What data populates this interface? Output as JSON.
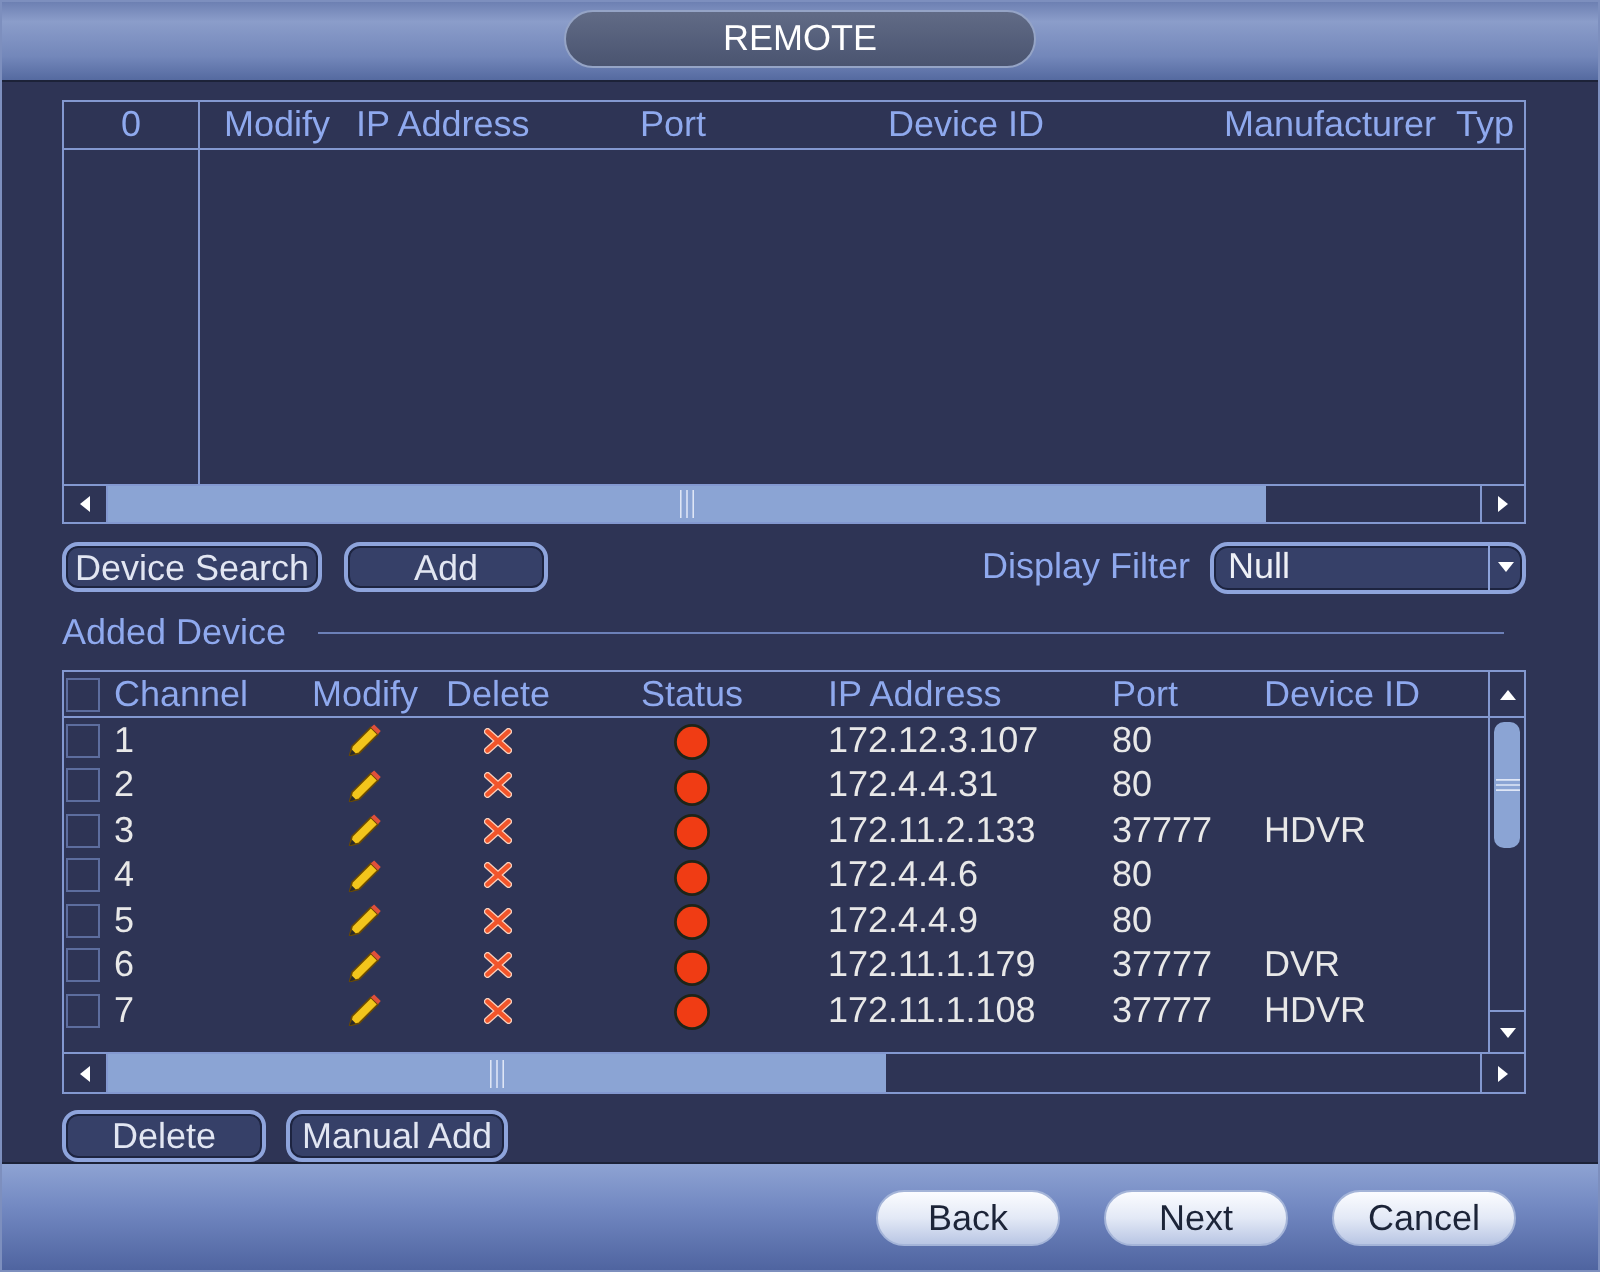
{
  "window": {
    "title": "REMOTE"
  },
  "device_list": {
    "count": "0",
    "columns": [
      "Modify",
      "IP Address",
      "Port",
      "Device ID",
      "Manufacturer",
      "Typ"
    ]
  },
  "search_buttons": [
    "Device Search",
    "Add"
  ],
  "display_filter": {
    "label": "Display Filter",
    "value": "Null"
  },
  "added_device": {
    "title": "Added Device",
    "select_all_checked": false,
    "columns": [
      "Channel",
      "Modify",
      "Delete",
      "Status",
      "IP Address",
      "Port",
      "Device ID"
    ],
    "rows": [
      {
        "checked": false,
        "channel": "1",
        "color": "#f03c14",
        "ip_address": "172.12.3.107",
        "port": "80"
      },
      {
        "checked": false,
        "channel": "2",
        "color": "#f03c14",
        "ip_address": "172.4.4.31",
        "port": "80"
      },
      {
        "checked": false,
        "channel": "3",
        "color": "#f03c14",
        "ip_address": "172.11.2.133",
        "port": "37777",
        "device_id": "HDVR"
      },
      {
        "checked": false,
        "channel": "4",
        "color": "#f03c14",
        "ip_address": "172.4.4.6",
        "port": "80"
      },
      {
        "checked": false,
        "channel": "5",
        "color": "#f03c14",
        "ip_address": "172.4.4.9",
        "port": "80"
      },
      {
        "checked": false,
        "channel": "6",
        "color": "#f03c14",
        "ip_address": "172.11.1.179",
        "port": "37777",
        "device_id": "DVR"
      },
      {
        "checked": false,
        "channel": "7",
        "color": "#f03c14",
        "ip_address": "172.11.1.108",
        "port": "37777",
        "device_id": "HDVR"
      }
    ]
  },
  "device_actions": [
    "Delete",
    "Manual Add"
  ],
  "footer_buttons": [
    "Back",
    "Next",
    "Cancel"
  ]
}
